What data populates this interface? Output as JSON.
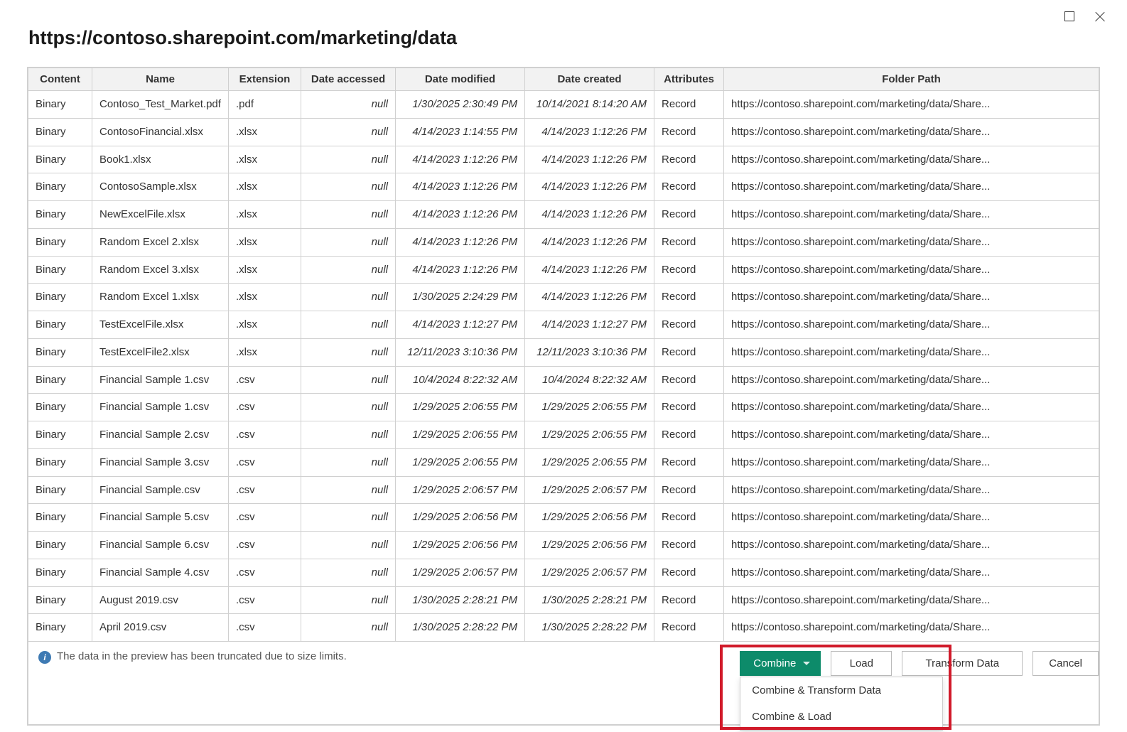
{
  "title": "https://contoso.sharepoint.com/marketing/data",
  "columns": [
    "Content",
    "Name",
    "Extension",
    "Date accessed",
    "Date modified",
    "Date created",
    "Attributes",
    "Folder Path"
  ],
  "folder_path_display": "https://contoso.sharepoint.com/marketing/data/Share...",
  "null_text": "null",
  "rows": [
    {
      "content": "Binary",
      "name": "Contoso_Test_Market.pdf",
      "ext": ".pdf",
      "accessed": "null",
      "modified": "1/30/2025 2:30:49 PM",
      "created": "10/14/2021 8:14:20 AM",
      "attr": "Record"
    },
    {
      "content": "Binary",
      "name": "ContosoFinancial.xlsx",
      "ext": ".xlsx",
      "accessed": "null",
      "modified": "4/14/2023 1:14:55 PM",
      "created": "4/14/2023 1:12:26 PM",
      "attr": "Record"
    },
    {
      "content": "Binary",
      "name": "Book1.xlsx",
      "ext": ".xlsx",
      "accessed": "null",
      "modified": "4/14/2023 1:12:26 PM",
      "created": "4/14/2023 1:12:26 PM",
      "attr": "Record"
    },
    {
      "content": "Binary",
      "name": "ContosoSample.xlsx",
      "ext": ".xlsx",
      "accessed": "null",
      "modified": "4/14/2023 1:12:26 PM",
      "created": "4/14/2023 1:12:26 PM",
      "attr": "Record"
    },
    {
      "content": "Binary",
      "name": "NewExcelFile.xlsx",
      "ext": ".xlsx",
      "accessed": "null",
      "modified": "4/14/2023 1:12:26 PM",
      "created": "4/14/2023 1:12:26 PM",
      "attr": "Record"
    },
    {
      "content": "Binary",
      "name": "Random Excel 2.xlsx",
      "ext": ".xlsx",
      "accessed": "null",
      "modified": "4/14/2023 1:12:26 PM",
      "created": "4/14/2023 1:12:26 PM",
      "attr": "Record"
    },
    {
      "content": "Binary",
      "name": "Random Excel 3.xlsx",
      "ext": ".xlsx",
      "accessed": "null",
      "modified": "4/14/2023 1:12:26 PM",
      "created": "4/14/2023 1:12:26 PM",
      "attr": "Record"
    },
    {
      "content": "Binary",
      "name": "Random Excel 1.xlsx",
      "ext": ".xlsx",
      "accessed": "null",
      "modified": "1/30/2025 2:24:29 PM",
      "created": "4/14/2023 1:12:26 PM",
      "attr": "Record"
    },
    {
      "content": "Binary",
      "name": "TestExcelFile.xlsx",
      "ext": ".xlsx",
      "accessed": "null",
      "modified": "4/14/2023 1:12:27 PM",
      "created": "4/14/2023 1:12:27 PM",
      "attr": "Record"
    },
    {
      "content": "Binary",
      "name": "TestExcelFile2.xlsx",
      "ext": ".xlsx",
      "accessed": "null",
      "modified": "12/11/2023 3:10:36 PM",
      "created": "12/11/2023 3:10:36 PM",
      "attr": "Record"
    },
    {
      "content": "Binary",
      "name": "Financial Sample 1.csv",
      "ext": ".csv",
      "accessed": "null",
      "modified": "10/4/2024 8:22:32 AM",
      "created": "10/4/2024 8:22:32 AM",
      "attr": "Record"
    },
    {
      "content": "Binary",
      "name": "Financial Sample 1.csv",
      "ext": ".csv",
      "accessed": "null",
      "modified": "1/29/2025 2:06:55 PM",
      "created": "1/29/2025 2:06:55 PM",
      "attr": "Record"
    },
    {
      "content": "Binary",
      "name": "Financial Sample 2.csv",
      "ext": ".csv",
      "accessed": "null",
      "modified": "1/29/2025 2:06:55 PM",
      "created": "1/29/2025 2:06:55 PM",
      "attr": "Record"
    },
    {
      "content": "Binary",
      "name": "Financial Sample 3.csv",
      "ext": ".csv",
      "accessed": "null",
      "modified": "1/29/2025 2:06:55 PM",
      "created": "1/29/2025 2:06:55 PM",
      "attr": "Record"
    },
    {
      "content": "Binary",
      "name": "Financial Sample.csv",
      "ext": ".csv",
      "accessed": "null",
      "modified": "1/29/2025 2:06:57 PM",
      "created": "1/29/2025 2:06:57 PM",
      "attr": "Record"
    },
    {
      "content": "Binary",
      "name": "Financial Sample 5.csv",
      "ext": ".csv",
      "accessed": "null",
      "modified": "1/29/2025 2:06:56 PM",
      "created": "1/29/2025 2:06:56 PM",
      "attr": "Record"
    },
    {
      "content": "Binary",
      "name": "Financial Sample 6.csv",
      "ext": ".csv",
      "accessed": "null",
      "modified": "1/29/2025 2:06:56 PM",
      "created": "1/29/2025 2:06:56 PM",
      "attr": "Record"
    },
    {
      "content": "Binary",
      "name": "Financial Sample 4.csv",
      "ext": ".csv",
      "accessed": "null",
      "modified": "1/29/2025 2:06:57 PM",
      "created": "1/29/2025 2:06:57 PM",
      "attr": "Record"
    },
    {
      "content": "Binary",
      "name": "August 2019.csv",
      "ext": ".csv",
      "accessed": "null",
      "modified": "1/30/2025 2:28:21 PM",
      "created": "1/30/2025 2:28:21 PM",
      "attr": "Record"
    },
    {
      "content": "Binary",
      "name": "April 2019.csv",
      "ext": ".csv",
      "accessed": "null",
      "modified": "1/30/2025 2:28:22 PM",
      "created": "1/30/2025 2:28:22 PM",
      "attr": "Record"
    }
  ],
  "truncation_message": "The data in the preview has been truncated due to size limits.",
  "buttons": {
    "combine": "Combine",
    "load": "Load",
    "transform": "Transform Data",
    "cancel": "Cancel"
  },
  "combine_menu": [
    "Combine & Transform Data",
    "Combine & Load"
  ]
}
